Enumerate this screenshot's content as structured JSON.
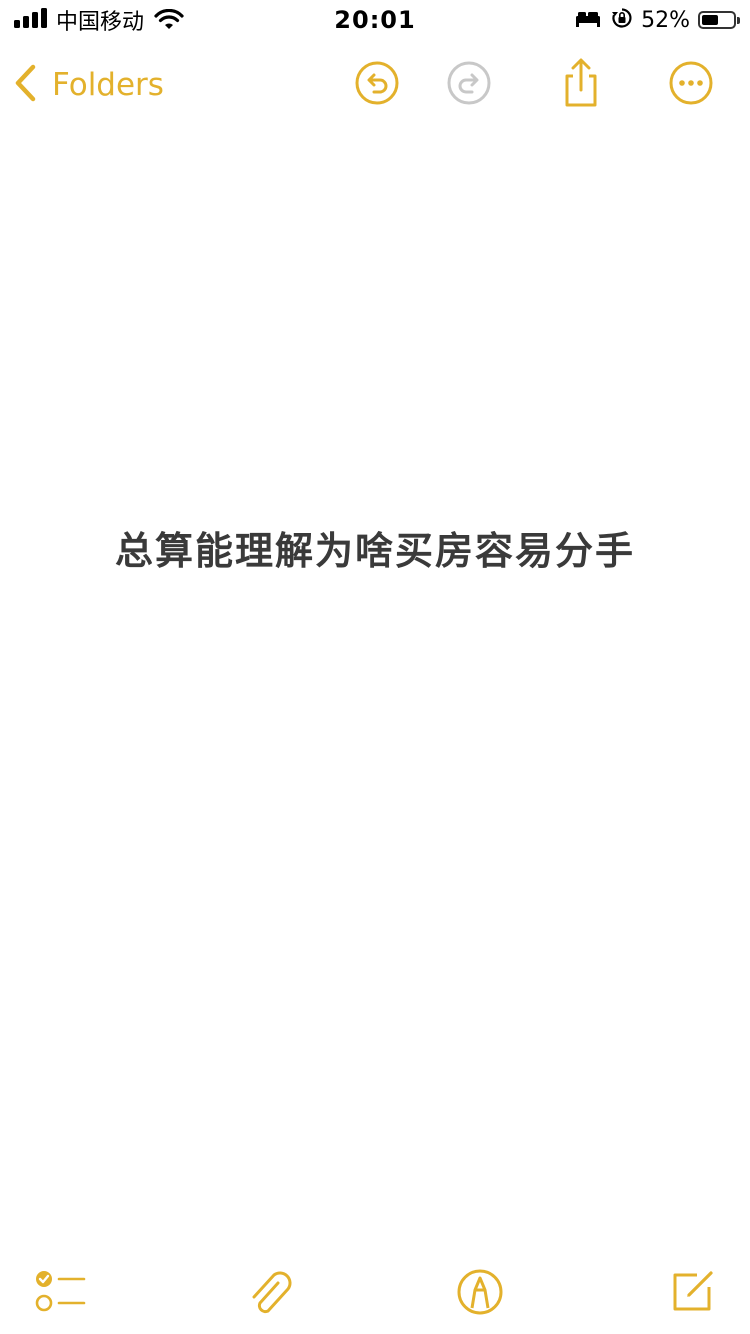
{
  "status_bar": {
    "carrier": "中国移动",
    "time": "20:01",
    "battery_percent": "52%",
    "battery_level": 0.52,
    "icons": [
      "signal-icon",
      "wifi-icon",
      "bed-icon",
      "orientation-lock-icon",
      "battery-icon"
    ]
  },
  "nav": {
    "back_label": "Folders",
    "icons": [
      "chevron-left-icon",
      "undo-icon",
      "redo-icon",
      "share-icon",
      "more-icon"
    ]
  },
  "note": {
    "text": "总算能理解为啥买房容易分手"
  },
  "toolbar": {
    "icons": [
      "checklist-icon",
      "paperclip-icon",
      "markup-icon",
      "compose-icon"
    ]
  },
  "colors": {
    "accent": "#e3b12c",
    "accent_disabled": "#c8c8c8",
    "text": "#3a3a3a",
    "background": "#ffffff"
  }
}
